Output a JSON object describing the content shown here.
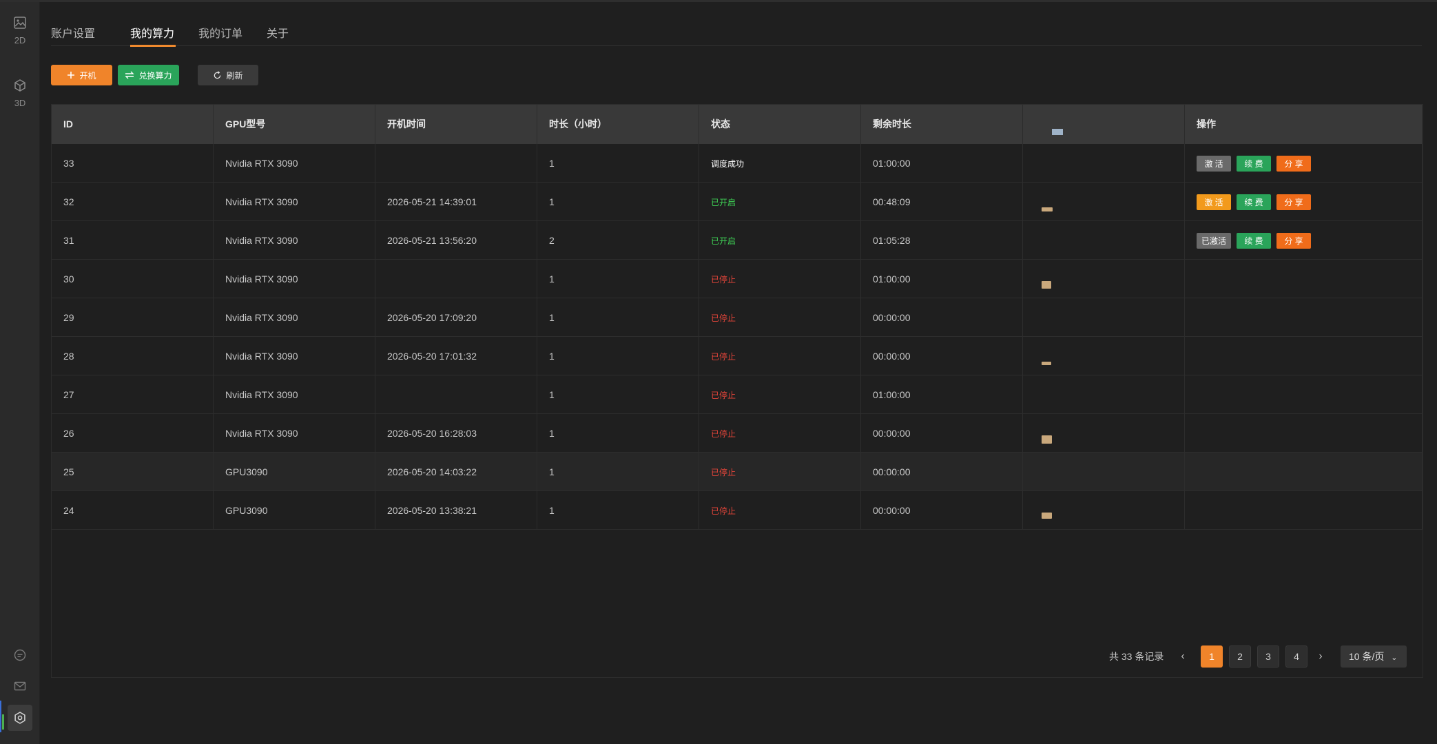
{
  "sidebar": {
    "items": [
      {
        "label": "2D",
        "icon": "image-icon"
      },
      {
        "label": "3D",
        "icon": "cube-icon"
      }
    ],
    "bottom_icons": [
      "chat-icon",
      "mail-icon",
      "settings-icon"
    ]
  },
  "tabs": [
    {
      "label": "账户设置",
      "active": false
    },
    {
      "label": "我的算力",
      "active": true
    },
    {
      "label": "我的订单",
      "active": false
    },
    {
      "label": "关于",
      "active": false
    }
  ],
  "toolbar": {
    "start_label": "开机",
    "exchange_label": "兑换算力",
    "refresh_label": "刷新"
  },
  "table": {
    "columns": [
      "ID",
      "GPU型号",
      "开机时间",
      "时长（小时）",
      "状态",
      "剩余时长",
      "",
      "操作"
    ],
    "rows": [
      {
        "id": "33",
        "gpu": "Nvidia RTX 3090",
        "start": "",
        "hours": "1",
        "status": "调度成功",
        "status_kind": "ok",
        "remain": "01:00:00",
        "ops": [
          "激 活",
          "续 费",
          "分 享"
        ],
        "op_kinds": [
          "gray",
          "green",
          "orange"
        ]
      },
      {
        "id": "32",
        "gpu": "Nvidia RTX 3090",
        "start": "2026-05-21 14:39:01",
        "hours": "1",
        "status": "已开启",
        "status_kind": "on",
        "remain": "00:48:09",
        "ops": [
          "激 活",
          "续 费",
          "分 享"
        ],
        "op_kinds": [
          "amber",
          "green",
          "orange"
        ]
      },
      {
        "id": "31",
        "gpu": "Nvidia RTX 3090",
        "start": "2026-05-21 13:56:20",
        "hours": "2",
        "status": "已开启",
        "status_kind": "on",
        "remain": "01:05:28",
        "ops": [
          "已激活",
          "续 费",
          "分 享"
        ],
        "op_kinds": [
          "gray",
          "green",
          "orange"
        ]
      },
      {
        "id": "30",
        "gpu": "Nvidia RTX 3090",
        "start": "",
        "hours": "1",
        "status": "已停止",
        "status_kind": "off",
        "remain": "01:00:00",
        "ops": [],
        "op_kinds": []
      },
      {
        "id": "29",
        "gpu": "Nvidia RTX 3090",
        "start": "2026-05-20 17:09:20",
        "hours": "1",
        "status": "已停止",
        "status_kind": "off",
        "remain": "00:00:00",
        "ops": [],
        "op_kinds": []
      },
      {
        "id": "28",
        "gpu": "Nvidia RTX 3090",
        "start": "2026-05-20 17:01:32",
        "hours": "1",
        "status": "已停止",
        "status_kind": "off",
        "remain": "00:00:00",
        "ops": [],
        "op_kinds": []
      },
      {
        "id": "27",
        "gpu": "Nvidia RTX 3090",
        "start": "",
        "hours": "1",
        "status": "已停止",
        "status_kind": "off",
        "remain": "01:00:00",
        "ops": [],
        "op_kinds": []
      },
      {
        "id": "26",
        "gpu": "Nvidia RTX 3090",
        "start": "2026-05-20 16:28:03",
        "hours": "1",
        "status": "已停止",
        "status_kind": "off",
        "remain": "00:00:00",
        "ops": [],
        "op_kinds": []
      },
      {
        "id": "25",
        "gpu": "GPU3090",
        "start": "2026-05-20 14:03:22",
        "hours": "1",
        "status": "已停止",
        "status_kind": "off",
        "remain": "00:00:00",
        "ops": [],
        "op_kinds": []
      },
      {
        "id": "24",
        "gpu": "GPU3090",
        "start": "2026-05-20 13:38:21",
        "hours": "1",
        "status": "已停止",
        "status_kind": "off",
        "remain": "00:00:00",
        "ops": [],
        "op_kinds": []
      }
    ]
  },
  "pagination": {
    "total_text": "共 33 条记录",
    "pages": [
      "1",
      "2",
      "3",
      "4"
    ],
    "current": "1",
    "page_size": "10 条/页"
  },
  "colors": {
    "accent": "#f0842a",
    "green": "#2aa45a",
    "status_on": "#3ecf54",
    "status_off": "#e6453a"
  }
}
